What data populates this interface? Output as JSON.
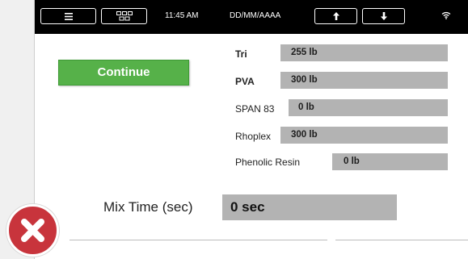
{
  "topbar": {
    "menu_icon": "hamburger-icon",
    "grid_icon": "grid-icon",
    "time": "11:45 AM",
    "date": "DD/MM/AAAA",
    "up_icon": "arrow-up-icon",
    "down_icon": "arrow-down-icon",
    "wifi_icon": "wifi-icon"
  },
  "continue_label": "Continue",
  "materials": [
    {
      "name": "Tri",
      "value": "255 lb"
    },
    {
      "name": "PVA",
      "value": "300 lb"
    },
    {
      "name": "SPAN 83",
      "value": "0 lb"
    },
    {
      "name": "Rhoplex",
      "value": "300 lb"
    },
    {
      "name": "Phenolic Resin",
      "value": "0 lb"
    }
  ],
  "mix": {
    "label": "Mix Time (sec)",
    "value": "0 sec"
  },
  "error_icon": "error-x-icon",
  "colors": {
    "accent_green": "#56b149",
    "bar_gray": "#b3b3b3",
    "error_red": "#c8343c",
    "topbar": "#000000"
  }
}
